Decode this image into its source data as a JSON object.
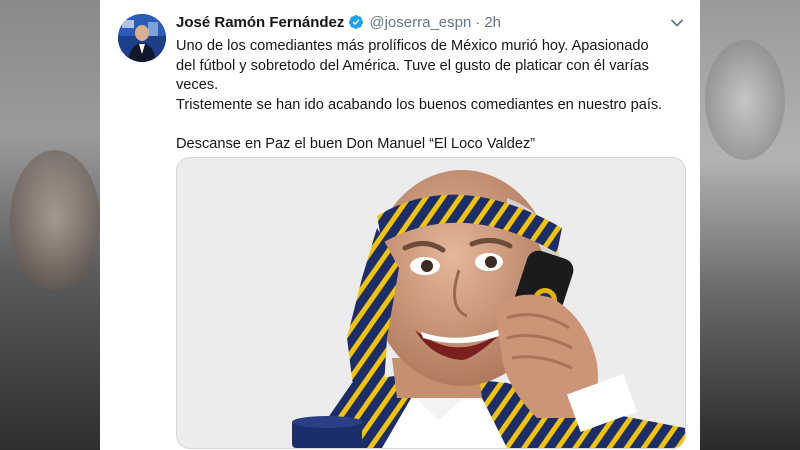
{
  "author": {
    "name": "José Ramón Fernández",
    "handle": "@joserra_espn",
    "separator": "·",
    "time": "2h"
  },
  "tweet": {
    "lines": [
      "Uno de los comediantes más prolíficos de México murió hoy. Apasionado",
      "del fútbol y sobretodo del América. Tuve el gusto de platicar con él varías",
      "veces.",
      "Tristemente se han ido acabando los  buenos comediantes en nuestro país.",
      "Descanse en Paz el buen Don Manuel “El Loco Valdez”"
    ]
  },
  "colors": {
    "verified": "#1da1f2",
    "text": "#14171a",
    "secondary": "#657786",
    "tie_navy": "#1c2d6b",
    "tie_yellow": "#f2c300"
  },
  "icons": [
    "verified-badge-icon",
    "chevron-down-icon"
  ]
}
